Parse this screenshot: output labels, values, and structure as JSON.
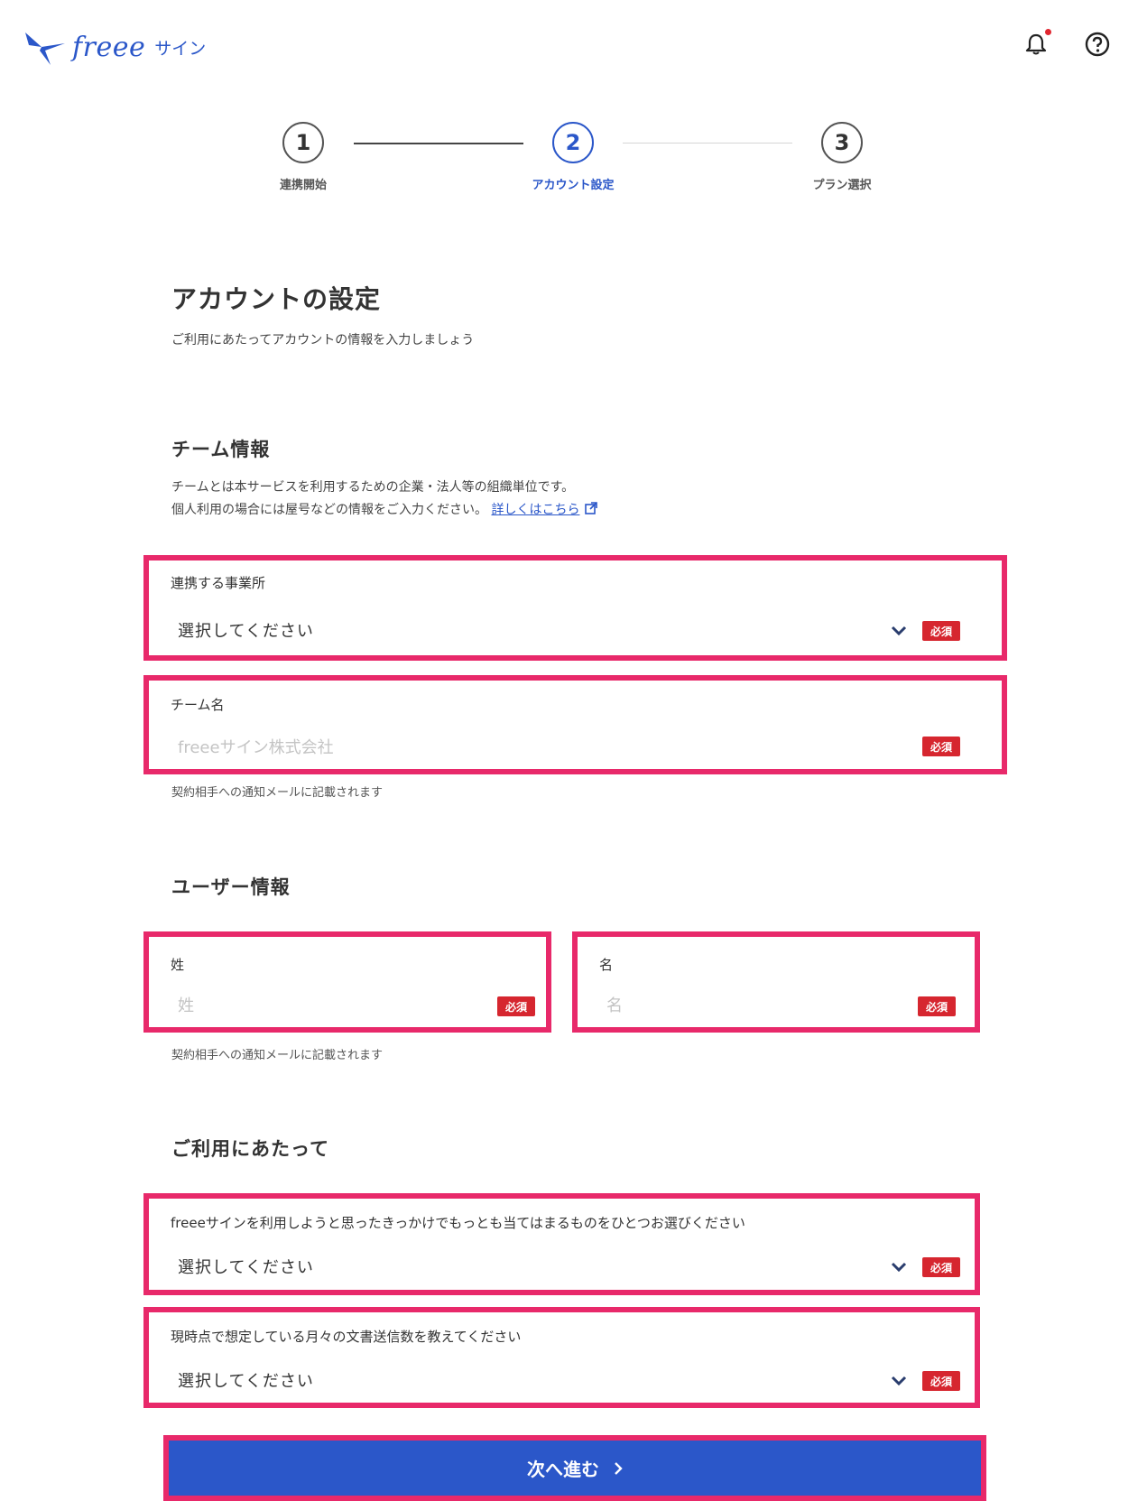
{
  "header": {
    "logo_text": "freee",
    "logo_sub": "サイン",
    "bell_icon": "bell-icon",
    "help_icon": "help-circle-icon"
  },
  "stepper": {
    "steps": [
      {
        "number": "1",
        "label": "連携開始",
        "state": "done"
      },
      {
        "number": "2",
        "label": "アカウント設定",
        "state": "active"
      },
      {
        "number": "3",
        "label": "プラン選択",
        "state": "pending"
      }
    ]
  },
  "page": {
    "title": "アカウントの設定",
    "subtitle": "ご利用にあたってアカウントの情報を入力しましょう"
  },
  "team": {
    "heading": "チーム情報",
    "desc_line1": "チームとは本サービスを利用するための企業・法人等の組織単位です。",
    "desc_line2": "個人利用の場合には屋号などの情報をご入力ください。",
    "link_text": "詳しくはこちら",
    "office_label": "連携する事業所",
    "office_value": "選択してください",
    "team_name_label": "チーム名",
    "team_name_placeholder": "freeeサイン株式会社",
    "note": "契約相手への通知メールに記載されます"
  },
  "user": {
    "heading": "ユーザー情報",
    "last_name_label": "姓",
    "last_name_placeholder": "姓",
    "first_name_label": "名",
    "first_name_placeholder": "名",
    "note": "契約相手への通知メールに記載されます"
  },
  "usage": {
    "heading": "ご利用にあたって",
    "reason_label": "freeeサインを利用しようと思ったきっかけでもっとも当てはまるものをひとつお選びください",
    "reason_value": "選択してください",
    "volume_label": "現時点で想定している月々の文書送信数を教えてください",
    "volume_value": "選択してください"
  },
  "required_badge": "必須",
  "submit_label": "次へ進む",
  "colors": {
    "brand": "#2b57c9",
    "highlight": "#e8296a",
    "required": "#d6262f"
  }
}
